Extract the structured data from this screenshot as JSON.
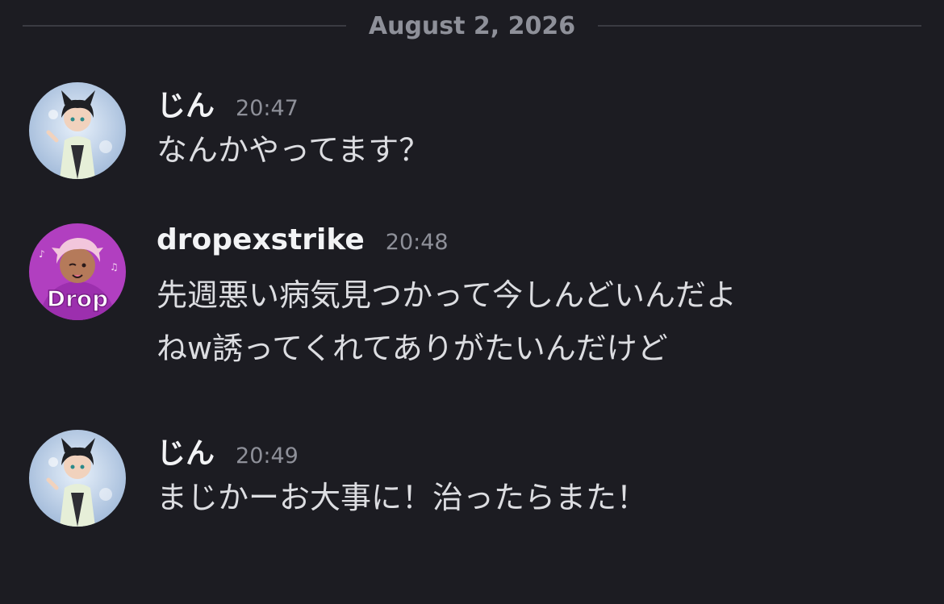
{
  "date_divider": {
    "label": "August 2, 2026"
  },
  "messages": [
    {
      "username": "じん",
      "timestamp": "20:47",
      "lines": [
        "なんかやってます？"
      ],
      "avatar_icon": "cat-ear-character-avatar-icon"
    },
    {
      "username": "dropexstrike",
      "timestamp": "20:48",
      "lines": [
        "先週悪い病気見つかって今しんどいんだよ",
        "ねw誘ってくれてありがたいんだけど"
      ],
      "avatar_icon": "drop-character-avatar-icon",
      "avatar_text": "Drop"
    },
    {
      "username": "じん",
      "timestamp": "20:49",
      "lines": [
        "まじかーお大事に！治ったらまた！"
      ],
      "avatar_icon": "cat-ear-character-avatar-icon"
    }
  ],
  "colors": {
    "background": "#1c1c22",
    "divider": "#3a3b42",
    "muted_text": "#8e9099",
    "username": "#f2f3f5",
    "message_text": "#dcdde1",
    "drop_avatar_bg": "#b13fc0"
  }
}
